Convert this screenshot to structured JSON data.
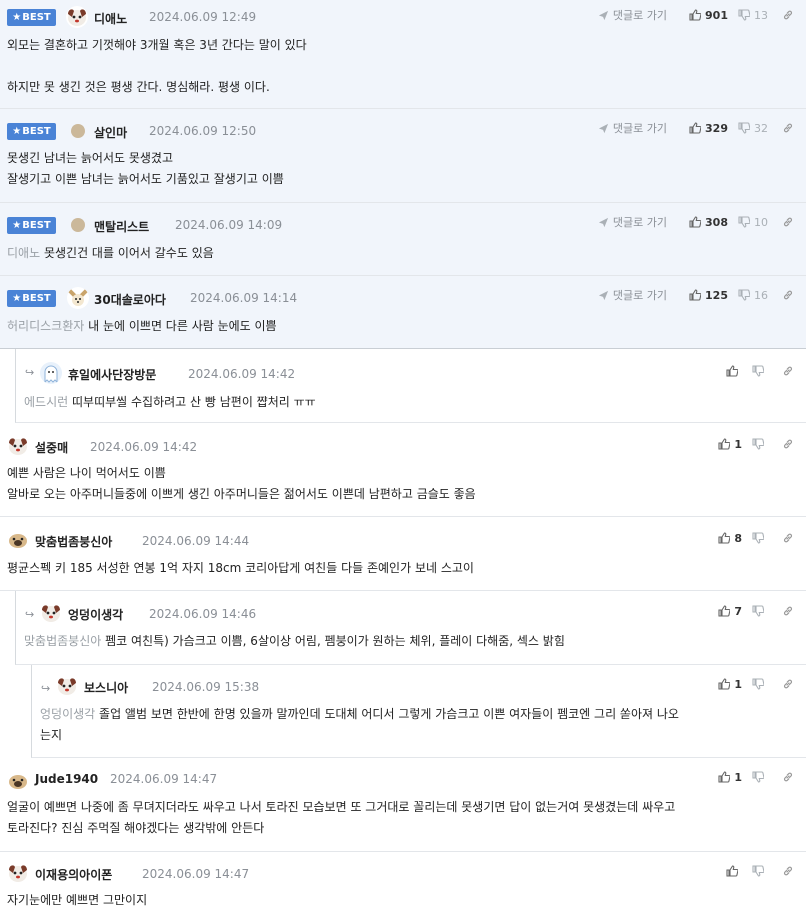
{
  "ui": {
    "best_label": "BEST",
    "reply_link_label": "댓글로 가기",
    "colors": {
      "best_bg": "#f1f5fb",
      "badge": "#4a83d6",
      "muted": "#8a8f96"
    }
  },
  "comments": [
    {
      "nick": "디애노",
      "date": "2024.06.09 12:49",
      "up": "901",
      "down": "13",
      "lines": [
        "외모는 결혼하고 기껏해야 3개월 혹은 3년 간다는 말이 있다",
        "",
        "하지만 못 생긴 것은 평생 간다. 명심해라. 평생 이다."
      ]
    },
    {
      "nick": "살인마",
      "date": "2024.06.09 12:50",
      "up": "329",
      "down": "32",
      "lines": [
        "못생긴 남녀는 늙어서도 못생겼고",
        "잘생기고 이쁜 남녀는 늙어서도 기품있고 잘생기고 이쁨"
      ]
    },
    {
      "nick": "맨탈리스트",
      "date": "2024.06.09 14:09",
      "up": "308",
      "down": "10",
      "mention": "디애노",
      "text": "못생긴건 대를 이어서 갈수도 있음"
    },
    {
      "nick": "30대솔로아다",
      "date": "2024.06.09 14:14",
      "up": "125",
      "down": "16",
      "mention": "허리디스크환자",
      "text": "내 눈에 이쁘면 다른 사람 눈에도 이쁨"
    },
    {
      "nick": "휴일에사단장방문",
      "date": "2024.06.09 14:42",
      "up": "",
      "mention": "에드시런",
      "text": "띠부띠부씰 수집하려고 산 빵 남편이 쨥처리 ㅠㅠ"
    },
    {
      "nick": "설중매",
      "date": "2024.06.09 14:42",
      "up": "1",
      "lines": [
        "예쁜 사람은 나이 먹어서도 이쁨",
        "알바로 오는 아주머니들중에 이쁘게 생긴 아주머니들은 젊어서도 이쁜데 남편하고 금슬도 좋음"
      ]
    },
    {
      "nick": "맞춤법좀붕신아",
      "date": "2024.06.09 14:44",
      "up": "8",
      "text": "평균스펙 키 185 서성한 연봉 1억 자지 18cm 코리아답게 여친들 다들 존예인가 보네 스고이"
    },
    {
      "nick": "엉덩이생각",
      "date": "2024.06.09 14:46",
      "up": "7",
      "mention": "맞춤법좀붕신아",
      "text": "펨코 여친특) 가슴크고 이쁨, 6살이상 어림, 펨붕이가 원하는 체위, 플레이 다해줌, 섹스 밝힘"
    },
    {
      "nick": "보스니아",
      "date": "2024.06.09 15:38",
      "up": "1",
      "mention": "엉덩이생각",
      "lines": [
        "졸업 앨범 보면 한반에 한명 있을까 말까인데 도대체 어디서 그렇게 가슴크고 이쁜 여자들이 펨코엔 그리 쏟아져 나오",
        "는지"
      ]
    },
    {
      "nick": "Jude1940",
      "date": "2024.06.09 14:47",
      "up": "1",
      "lines": [
        "얼굴이 예쁘면 나중에 좀 무뎌지더라도 싸우고 나서 토라진 모습보면 또 그거대로 꼴리는데 못생기면 답이 없는거여 못생겼는데 싸우고",
        "토라진다? 진심 주먹질 해야겠다는 생각밖에 안든다"
      ]
    },
    {
      "nick": "이재용의아이폰",
      "date": "2024.06.09 14:47",
      "up": "",
      "text": "자기눈에만 예쁘면 그만이지"
    }
  ]
}
